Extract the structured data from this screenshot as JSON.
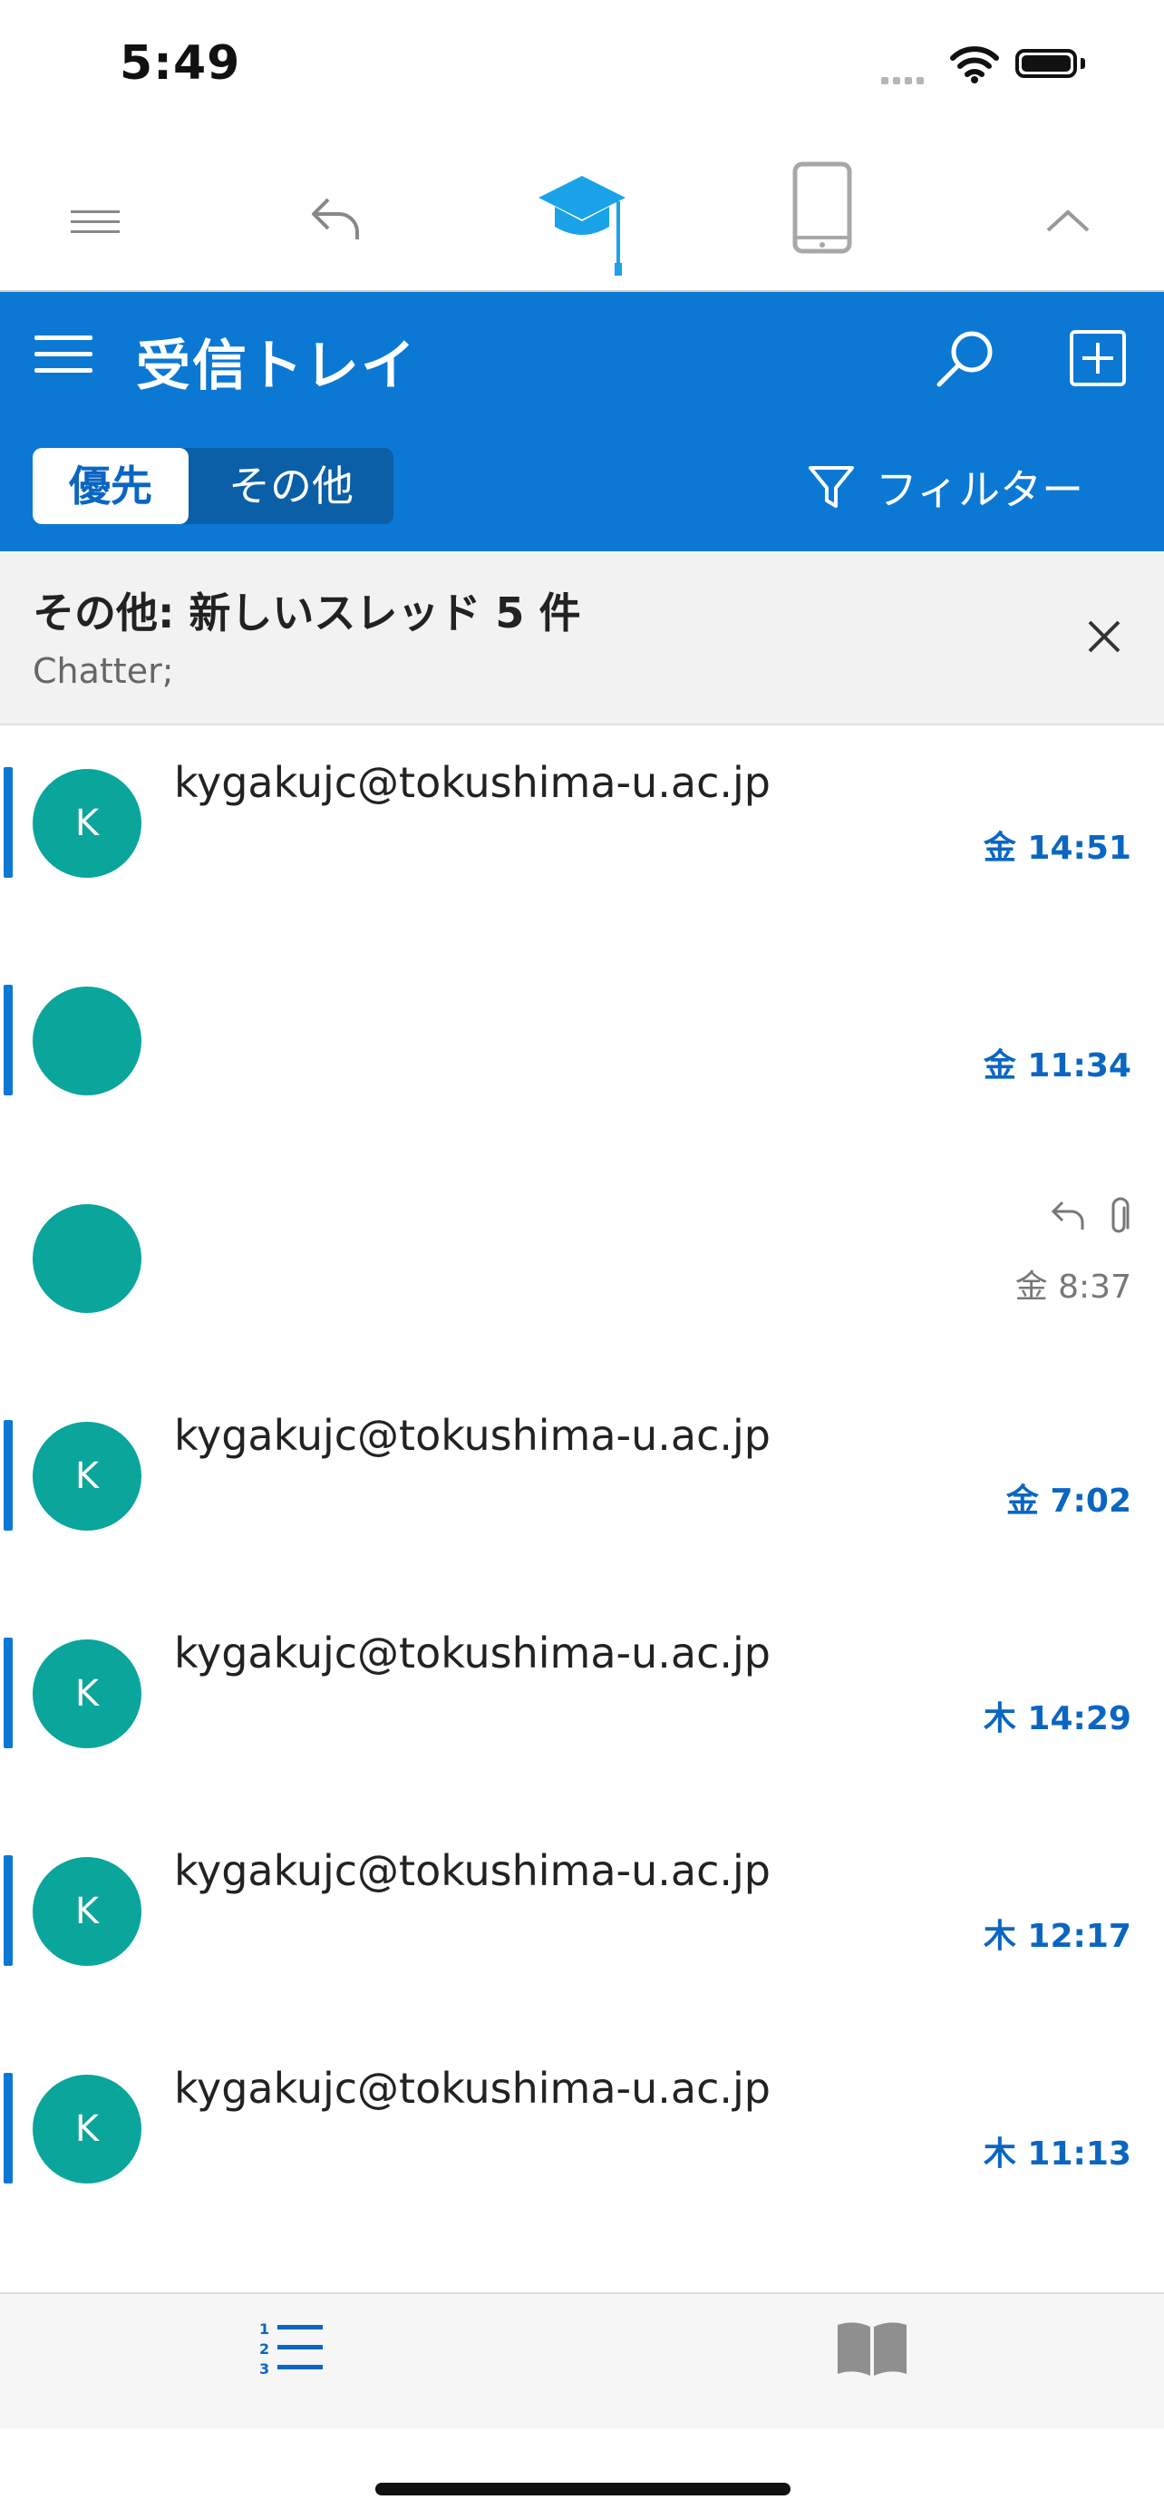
{
  "status_bar": {
    "time": "5:49"
  },
  "addin_toolbar": {
    "icons": [
      "menu-lines-icon",
      "reply-arrow-icon",
      "graduation-cap-icon",
      "phone-icon",
      "chevron-up-icon"
    ]
  },
  "header": {
    "title": "受信トレイ",
    "tabs": {
      "focused": "優先",
      "other": "その他"
    },
    "filter_label": "フィルター",
    "colors": {
      "header_bg": "#0b78d4",
      "accent": "#0b66c2",
      "avatar": "#0aa59b"
    }
  },
  "notice": {
    "title": "その他: 新しいスレッド 5 件",
    "subtitle": "Chatter;"
  },
  "messages": [
    {
      "sender": "kygakujc@tokushima-u.ac.jp",
      "initial": "K",
      "time": "金 14:51",
      "unread": true
    },
    {
      "sender": "",
      "initial": "",
      "time": "金 11:34",
      "unread": true
    },
    {
      "sender": "",
      "initial": "",
      "time": "金 8:37",
      "unread": false,
      "icons": [
        "reply-icon",
        "paperclip-icon"
      ]
    },
    {
      "sender": "kygakujc@tokushima-u.ac.jp",
      "initial": "K",
      "time": "金 7:02",
      "unread": true
    },
    {
      "sender": "kygakujc@tokushima-u.ac.jp",
      "initial": "K",
      "time": "木 14:29",
      "unread": true
    },
    {
      "sender": "kygakujc@tokushima-u.ac.jp",
      "initial": "K",
      "time": "木 12:17",
      "unread": true
    },
    {
      "sender": "kygakujc@tokushima-u.ac.jp",
      "initial": "K",
      "time": "木 11:13",
      "unread": true
    }
  ],
  "bottom_bar": {
    "items": [
      "numbered-list-icon",
      "book-icon"
    ],
    "active": 0
  }
}
